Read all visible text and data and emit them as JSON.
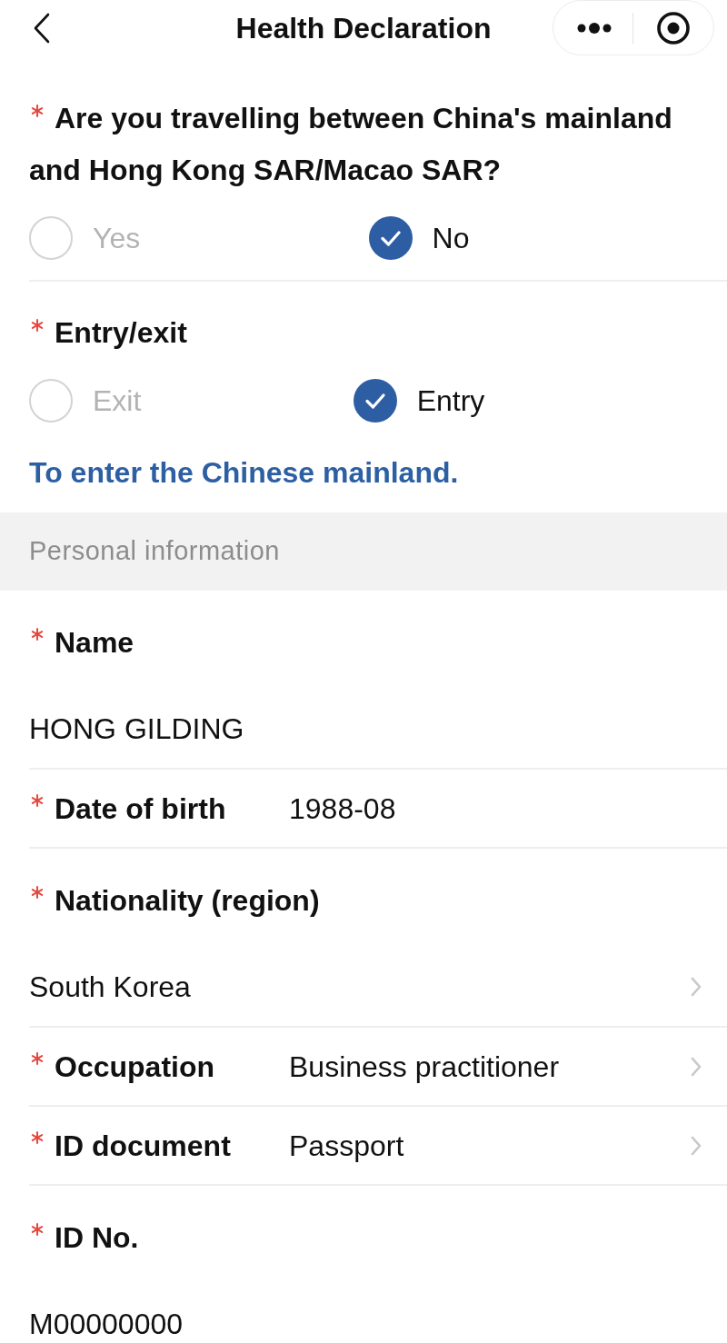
{
  "header": {
    "title": "Health Declaration"
  },
  "questions": [
    {
      "label": "Are you travelling between China's mainland and Hong Kong SAR/Macao SAR?",
      "required": true,
      "options": [
        {
          "label": "Yes",
          "selected": false
        },
        {
          "label": "No",
          "selected": true
        }
      ]
    },
    {
      "label": "Entry/exit",
      "required": true,
      "options": [
        {
          "label": "Exit",
          "selected": false
        },
        {
          "label": "Entry",
          "selected": true
        }
      ]
    }
  ],
  "note": "To enter the Chinese mainland.",
  "section": {
    "title": "Personal information"
  },
  "fields": [
    {
      "label": "Name",
      "required": true,
      "value": "HONG GILDING",
      "stacked": true,
      "kind": "text"
    },
    {
      "label": "Date of birth",
      "required": true,
      "value": "1988-08",
      "stacked": false,
      "kind": "text"
    },
    {
      "label": "Nationality (region)",
      "required": true,
      "value": "South Korea",
      "stacked": true,
      "kind": "picker"
    },
    {
      "label": "Occupation",
      "required": true,
      "value": "Business practitioner",
      "stacked": false,
      "kind": "picker"
    },
    {
      "label": "ID document",
      "required": true,
      "value": "Passport",
      "stacked": false,
      "kind": "picker"
    },
    {
      "label": "ID No.",
      "required": true,
      "value": "M00000000",
      "stacked": true,
      "kind": "text"
    }
  ]
}
